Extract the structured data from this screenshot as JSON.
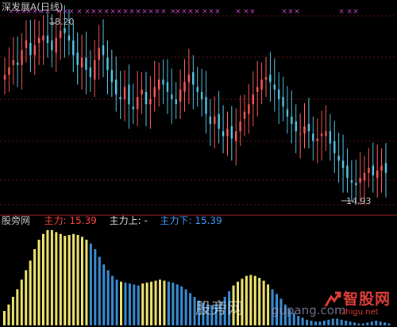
{
  "panel_top": {
    "title": "深发展A(日线)",
    "high_label": "18.20",
    "low_label": "14.93"
  },
  "panel_bottom": {
    "indicator_name": "股旁网",
    "main_label": "主力:",
    "main_value": "15.39",
    "up_label": "主力上:",
    "up_value": "-",
    "down_label": "主力下:",
    "down_value": "15.39"
  },
  "watermark": {
    "cn": "股旁网",
    "url": "gupang.com",
    "logo_text": "智股网",
    "logo_url": "zhigu.net"
  },
  "colors": {
    "background": "#000000",
    "up_candle": "#ff5a5a",
    "down_candle": "#54c8e8",
    "markers": "#d448d4",
    "separator": "#9a2020",
    "grid": "#6a1414",
    "main_value": "#ff4040",
    "down_value": "#3aa0ff",
    "bar_yellow": "#f2e870",
    "bar_blue": "#3a8ed6"
  },
  "chart_data": [
    {
      "type": "candlestick",
      "title": "深发展A(日线)",
      "annotations": [
        "18.20",
        "14.93"
      ],
      "ylim": [
        14.6,
        18.4
      ],
      "close": [
        17.2,
        17.35,
        17.5,
        17.4,
        17.7,
        17.9,
        17.6,
        17.8,
        17.95,
        18.0,
        17.85,
        17.7,
        17.95,
        18.1,
        18.05,
        17.9,
        17.6,
        17.4,
        17.55,
        17.3,
        17.15,
        17.5,
        17.75,
        17.6,
        17.3,
        17.05,
        16.8,
        16.7,
        16.95,
        16.6,
        16.5,
        16.75,
        16.9,
        16.6,
        16.7,
        16.95,
        17.1,
        17.0,
        16.85,
        16.7,
        16.6,
        16.9,
        17.05,
        17.2,
        17.0,
        16.85,
        16.7,
        16.4,
        16.2,
        16.35,
        16.1,
        15.95,
        16.1,
        15.9,
        16.05,
        16.25,
        16.45,
        16.6,
        16.8,
        16.95,
        17.1,
        17.15,
        17.05,
        16.9,
        16.7,
        16.55,
        16.35,
        16.2,
        16.05,
        16.0,
        16.15,
        16.05,
        15.85,
        15.9,
        16.0,
        16.05,
        15.8,
        15.6,
        15.45,
        15.3,
        15.1,
        15.0,
        14.95,
        15.1,
        15.2,
        15.3,
        15.15,
        15.25,
        15.35,
        15.2
      ],
      "markers_row": "top"
    },
    {
      "type": "bar",
      "title": "股旁网",
      "series": [
        {
          "name": "主力",
          "values": [
            0.15,
            0.22,
            0.3,
            0.38,
            0.48,
            0.58,
            0.68,
            0.8,
            0.9,
            0.96,
            1.0,
            1.0,
            0.98,
            0.96,
            0.94,
            0.95,
            0.96,
            0.95,
            0.93,
            0.9,
            0.86,
            0.8,
            0.72,
            0.64,
            0.58,
            0.52,
            0.48,
            0.46,
            0.45,
            0.44,
            0.43,
            0.42,
            0.44,
            0.45,
            0.46,
            0.47,
            0.48,
            0.47,
            0.46,
            0.45,
            0.43,
            0.41,
            0.38,
            0.34,
            0.3,
            0.26,
            0.24,
            0.22,
            0.21,
            0.22,
            0.25,
            0.3,
            0.36,
            0.42,
            0.46,
            0.49,
            0.52,
            0.53,
            0.52,
            0.5,
            0.47,
            0.43,
            0.38,
            0.33,
            0.28,
            0.22,
            0.17,
            0.13,
            0.1,
            0.08,
            0.06,
            0.05,
            0.04,
            0.04,
            0.05,
            0.06,
            0.07,
            0.07,
            0.06,
            0.05,
            0.04,
            0.03,
            0.02,
            0.02,
            0.03,
            0.04,
            0.05,
            0.04,
            0.03,
            0.02
          ]
        },
        {
          "name": "colors",
          "values": []
        }
      ],
      "bar_colors_pattern": "yyyyyyyyyyyyyyyyyyyybbbbbbbybbbbyyyyyybbbbbbbbbbbbbbbyyyyyyyyybbbbbbbbbbbbbbbbbbbbbbbbbbb"
    }
  ]
}
